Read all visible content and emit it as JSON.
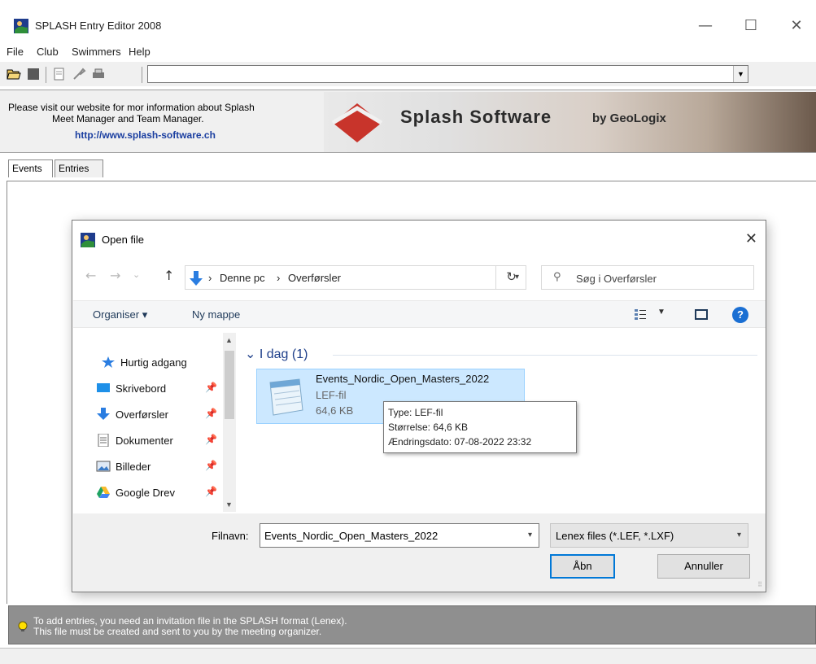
{
  "window": {
    "title": "SPLASH Entry Editor 2008",
    "controls": {
      "minimize": "—",
      "maximize": "☐",
      "close": "✕"
    }
  },
  "menu": [
    "File",
    "Club",
    "Swimmers",
    "Help"
  ],
  "toolbar": {
    "icons": [
      "open-folder-icon",
      "stop-icon",
      "properties-icon",
      "tools-icon",
      "print-icon"
    ],
    "combo_value": ""
  },
  "banner": {
    "line1": "Please visit our website for mor information about Splash",
    "line2": "Meet Manager and Team Manager.",
    "url": "http://www.splash-software.ch",
    "logo_text": "Splash Software",
    "logo_sub": "by GeoLogix"
  },
  "tabs": [
    "Events",
    "Entries"
  ],
  "status": {
    "line1": "To add entries, you need an invitation file in the SPLASH format (Lenex).",
    "line2": "This file must be created and sent to you by the meeting organizer."
  },
  "dialog": {
    "title": "Open file",
    "nav": {
      "back": "←",
      "forward": "→",
      "recent": "⌄",
      "up": "↑"
    },
    "path": [
      "Denne pc",
      "Overførsler"
    ],
    "path_separator": "›",
    "refresh": "↻",
    "search_placeholder": "Søg i Overførsler",
    "commands": {
      "organize": "Organiser ▾",
      "new_folder": "Ny mappe",
      "help": "?"
    },
    "sidebar": [
      {
        "label": "Hurtig adgang",
        "icon": "star-icon"
      },
      {
        "label": "Skrivebord",
        "icon": "desktop-icon",
        "pinned": true
      },
      {
        "label": "Overførsler",
        "icon": "download-icon",
        "pinned": true
      },
      {
        "label": "Dokumenter",
        "icon": "document-icon",
        "pinned": true
      },
      {
        "label": "Billeder",
        "icon": "pictures-icon",
        "pinned": true
      },
      {
        "label": "Google Drev",
        "icon": "google-drive-icon",
        "pinned": true
      }
    ],
    "pin_glyph": "📌",
    "group": {
      "label": "I dag (1)",
      "chevron": "⌄"
    },
    "file": {
      "name": "Events_Nordic_Open_Masters_2022",
      "type": "LEF-fil",
      "size": "64,6 KB"
    },
    "tooltip": {
      "type": "Type: LEF-fil",
      "size": "Størrelse: 64,6 KB",
      "modified": "Ændringsdato: 07-08-2022 23:32"
    },
    "filename_label": "Filnavn:",
    "filename_value": "Events_Nordic_Open_Masters_2022",
    "filter": "Lenex files (*.LEF, *.LXF)",
    "open_button": "Åbn",
    "cancel_button": "Annuller"
  },
  "colors": {
    "accent": "#0078d7",
    "selection": "#cce8ff",
    "url": "#1a3ea0",
    "status_bg": "#8f8f8f"
  }
}
